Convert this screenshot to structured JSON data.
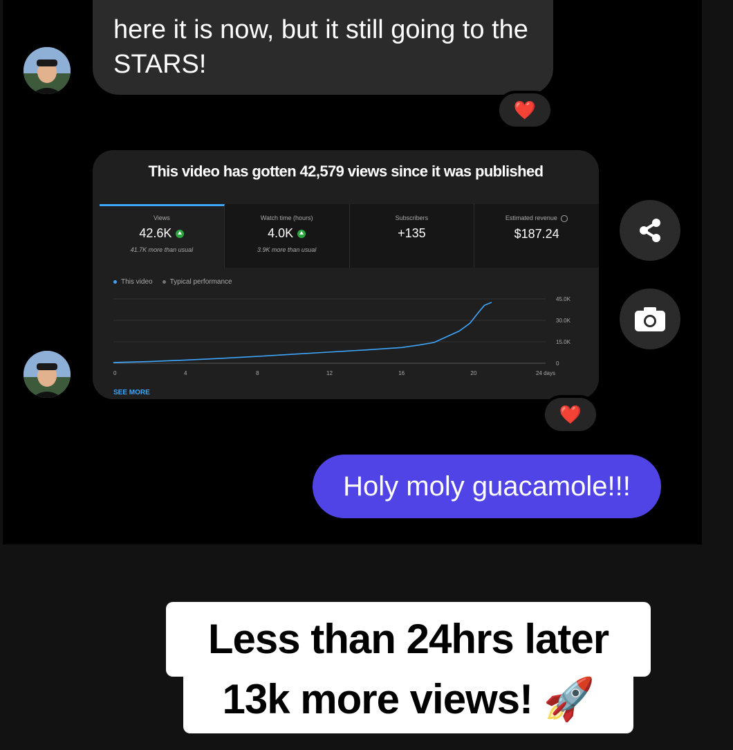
{
  "messages": {
    "incoming_text": "here it is now, but it still going to the STARS!",
    "outgoing_text": "Holy moly guacamole!!!",
    "reaction_emoji": "❤️"
  },
  "screenshot": {
    "title": "This video has gotten 42,579 views since it was published",
    "stats": [
      {
        "label": "Views",
        "value": "42.6K",
        "sub": "41.7K more than usual",
        "trend": "up"
      },
      {
        "label": "Watch time (hours)",
        "value": "4.0K",
        "sub": "3.9K more than usual",
        "trend": "up"
      },
      {
        "label": "Subscribers",
        "value": "+135",
        "sub": "",
        "trend": ""
      },
      {
        "label": "Estimated revenue",
        "value": "$187.24",
        "sub": "",
        "trend": ""
      }
    ],
    "legend": {
      "this_video": "This video",
      "typical": "Typical performance"
    },
    "see_more": "SEE MORE"
  },
  "chart_data": {
    "type": "line",
    "y_ticks": [
      "45.0K",
      "30.0K",
      "15.0K",
      "0"
    ],
    "x_ticks": [
      "0",
      "4",
      "8",
      "12",
      "16",
      "20",
      "24 days"
    ],
    "xlim": [
      0,
      24
    ],
    "ylim": [
      0,
      45000
    ],
    "series": [
      {
        "name": "This video",
        "color": "#3ea6ff",
        "x": [
          0,
          2,
          4,
          6,
          8,
          10,
          12,
          14,
          16,
          17,
          17.8,
          18.5,
          19.2,
          19.8,
          20.3,
          20.6,
          21
        ],
        "y": [
          500,
          1200,
          2200,
          3400,
          4800,
          6300,
          7800,
          9300,
          11000,
          12800,
          14500,
          18500,
          22500,
          28000,
          36000,
          40500,
          42579
        ]
      }
    ]
  },
  "caption": {
    "line1": "Less than 24hrs later",
    "line2": "13k more views! 🚀"
  },
  "icons": {
    "share": "share-icon",
    "camera": "camera-icon"
  },
  "colors": {
    "accent_blue": "#3ea6ff",
    "outgoing_bubble": "#5044e6",
    "up_green": "#2ba640"
  }
}
